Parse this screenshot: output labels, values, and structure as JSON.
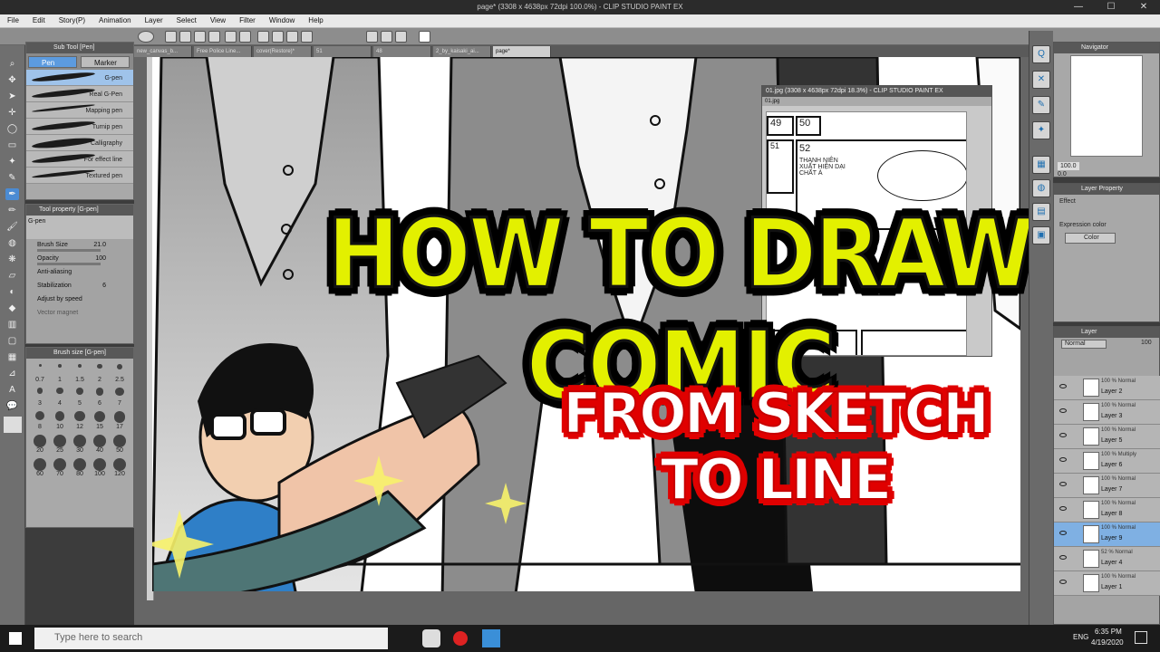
{
  "window": {
    "title": "page* (3308 x 4638px 72dpi 100.0%) - CLIP STUDIO PAINT EX",
    "min": "—",
    "max": "☐",
    "close": "✕"
  },
  "menu": [
    "File",
    "Edit",
    "Story(P)",
    "Animation",
    "Layer",
    "Select",
    "View",
    "Filter",
    "Window",
    "Help"
  ],
  "subtool": {
    "header": "Sub Tool [Pen]",
    "tabs": [
      "Pen",
      "Marker"
    ],
    "brushes": [
      "G-pen",
      "Real G-Pen",
      "Mapping pen",
      "Turnip pen",
      "Calligraphy",
      "For effect line",
      "Textured pen"
    ]
  },
  "toolprop": {
    "header": "Tool property [G-pen]",
    "tool": "G-pen",
    "rows": [
      {
        "label": "Brush Size",
        "value": "21.0"
      },
      {
        "label": "Opacity",
        "value": "100"
      },
      {
        "label": "Anti-aliasing",
        "value": ""
      },
      {
        "label": "Stabilization",
        "value": "6"
      },
      {
        "label": "Adjust by speed",
        "value": ""
      },
      {
        "label": "Vector magnet",
        "value": ""
      }
    ]
  },
  "brushsize": {
    "header": "Brush size [G-pen]",
    "sizes": [
      "0.7",
      "1",
      "1.5",
      "2",
      "2.5",
      "3",
      "4",
      "5",
      "6",
      "7",
      "8",
      "10",
      "12",
      "15",
      "17",
      "20",
      "25",
      "30",
      "40",
      "50",
      "60",
      "70",
      "80",
      "100",
      "120"
    ]
  },
  "doctabs": [
    "new_canvas_b...",
    "Free Police Line...",
    "cover(Restore)*",
    "51",
    "48",
    "2_by_kaisaki_ai...",
    "page*"
  ],
  "subwindow": {
    "title": "01.jpg (3308 x 4638px 72dpi 18.3%) - CLIP STUDIO PAINT EX",
    "tab": "01.jpg",
    "panel_nums": [
      "49",
      "50",
      "51",
      "52"
    ],
    "caption": "THANH NIÊN XUẤT HIỆN DẠI CHẤT À"
  },
  "navigator": {
    "header": "Navigator",
    "zoom": "100.0",
    "angle": "0.0"
  },
  "layerprop": {
    "header": "Layer Property",
    "effect": "Effect",
    "expression": "Expression color",
    "color": "Color"
  },
  "layers": {
    "header": "Layer",
    "blend": "Normal",
    "opacity": "100",
    "items": [
      {
        "mode": "100 % Normal",
        "name": "Layer 2"
      },
      {
        "mode": "100 % Normal",
        "name": "Layer 3"
      },
      {
        "mode": "100 % Normal",
        "name": "Layer 5"
      },
      {
        "mode": "100 % Multiply",
        "name": "Layer 6"
      },
      {
        "mode": "100 % Normal",
        "name": "Layer 7"
      },
      {
        "mode": "100 % Normal",
        "name": "Layer 8"
      },
      {
        "mode": "100 % Normal",
        "name": "Layer 9"
      },
      {
        "mode": "52 % Normal",
        "name": "Layer 4"
      },
      {
        "mode": "100 % Normal",
        "name": "Layer 1"
      }
    ],
    "selected_index": 6
  },
  "overlay": {
    "title": "HOW TO DRAW COMIC",
    "subtitle": "FROM SKETCH TO LINE"
  },
  "taskbar": {
    "search_placeholder": "Type here to search",
    "lang": "ENG",
    "time": "6:35 PM",
    "date": "4/19/2020"
  },
  "colors": {
    "title_fill": "#e3f000",
    "subtitle_outline": "#e00000",
    "selection": "#7fb0e3"
  }
}
